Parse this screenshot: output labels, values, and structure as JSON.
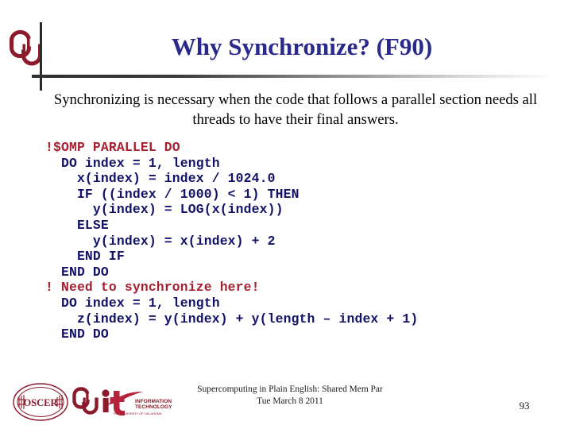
{
  "slide": {
    "title": "Why Synchronize? (F90)",
    "body_paragraph": "Synchronizing is necessary when the code that follows a parallel section needs all threads to have their final answers.",
    "page_number": "93"
  },
  "code": {
    "language": "Fortran 90 / OpenMP",
    "normal_color": "#121266",
    "accent_color": "#a52030",
    "lines": [
      {
        "text": "!$OMP PARALLEL DO",
        "accent": true
      },
      {
        "text": "  DO index = 1, length",
        "accent": false
      },
      {
        "text": "    x(index) = index / 1024.0",
        "accent": false
      },
      {
        "text": "    IF ((index / 1000) < 1) THEN",
        "accent": false
      },
      {
        "text": "      y(index) = LOG(x(index))",
        "accent": false
      },
      {
        "text": "    ELSE",
        "accent": false
      },
      {
        "text": "      y(index) = x(index) + 2",
        "accent": false
      },
      {
        "text": "    END IF",
        "accent": false
      },
      {
        "text": "  END DO",
        "accent": false
      },
      {
        "text": "! Need to synchronize here!",
        "accent": true
      },
      {
        "text": "  DO index = 1, length",
        "accent": false
      },
      {
        "text": "    z(index) = y(index) + y(length – index + 1)",
        "accent": false
      },
      {
        "text": "  END DO",
        "accent": false
      }
    ]
  },
  "footer": {
    "line1": "Supercomputing in Plain English: Shared Mem Par",
    "line2": "Tue March 8 2011",
    "logos": {
      "oscer_text": "OSCER",
      "it_text": "it",
      "it_sub1": "INFORMATION",
      "it_sub2": "TECHNOLOGY",
      "it_sub3": "THE UNIVERSITY OF OKLAHOMA",
      "ou_text": "OU"
    }
  },
  "colors": {
    "title_blue": "#2a2a8c",
    "code_navy": "#121266",
    "accent_red": "#a52030",
    "crimson": "#8b1a2b",
    "rule_dark": "#2f2f2f"
  }
}
